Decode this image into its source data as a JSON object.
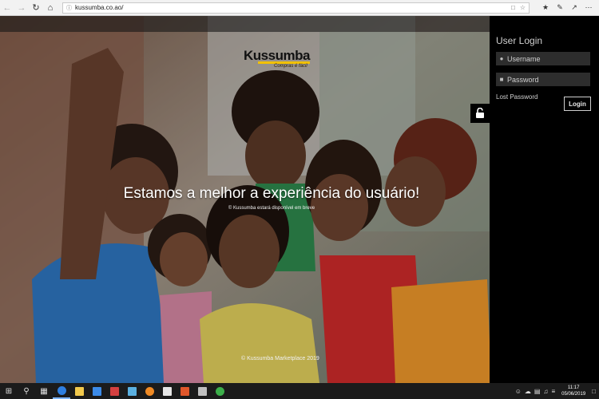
{
  "browser": {
    "url": "kussumba.co.ao/",
    "nav": {
      "back": "back-icon",
      "forward": "forward-icon",
      "refresh": "refresh-icon",
      "home": "home-icon"
    }
  },
  "hero": {
    "logo_word": "Kussumba",
    "logo_tagline": "Compras é fácil",
    "headline": "Estamos a melhor a experiência do usuário!",
    "subline": "© Kussumba estará disponível em breve",
    "footer": "© Kussumba Marketplace 2019"
  },
  "login": {
    "title": "User Login",
    "username_placeholder": "Username",
    "password_placeholder": "Password",
    "lost_password": "Lost Password",
    "login_button": "Login"
  },
  "taskbar": {
    "time": "11:17",
    "date": "05/06/2019"
  },
  "colors": {
    "brand_yellow": "#f2c100",
    "panel_bg": "#000000",
    "field_bg": "#2d2d2d"
  }
}
